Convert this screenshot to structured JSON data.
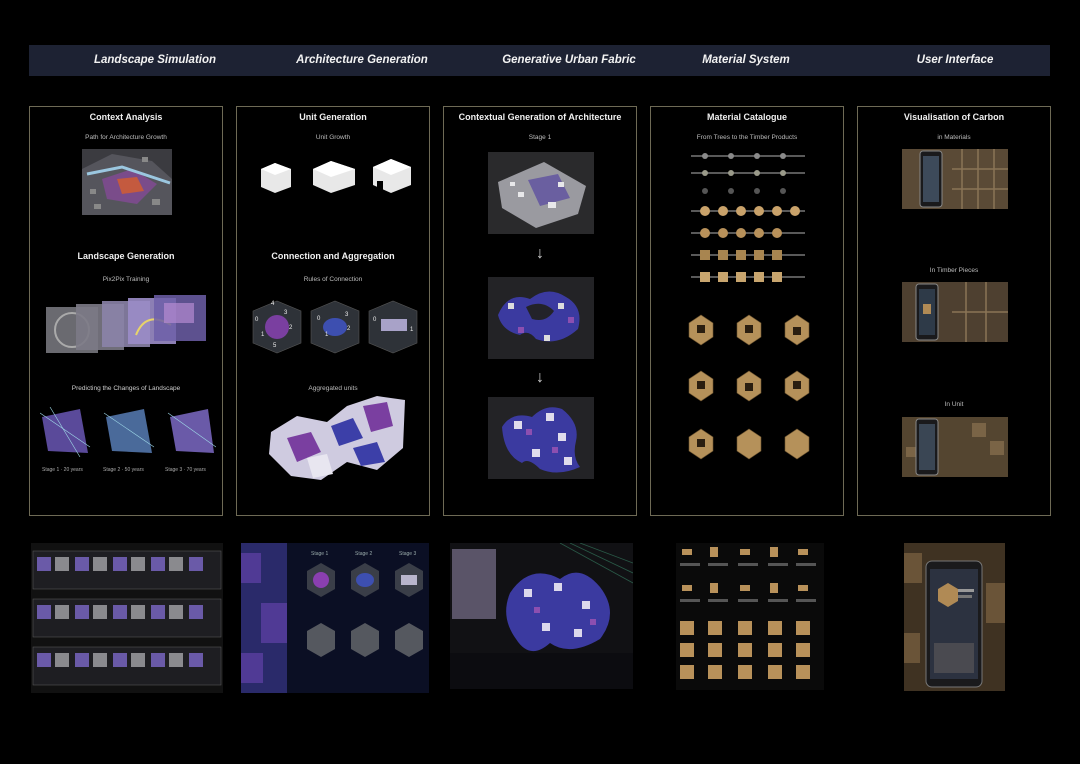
{
  "header": {
    "landscape": "Landscape Simulation",
    "architecture": "Architecture Generation",
    "urban": "Generative Urban Fabric",
    "material": "Material System",
    "ui": "User Interface"
  },
  "panel1": {
    "context_title": "Context Analysis",
    "context_sub": "Path for Architecture Growth",
    "landscape_title": "Landscape Generation",
    "landscape_sub": "Pix2Pix Training",
    "predict_title": "Predicting the Changes of Landscape",
    "stage1": "Stage 1 · 20 years",
    "stage2": "Stage 2 · 50 years",
    "stage3": "Stage 3 · 70 years"
  },
  "panel2": {
    "unit_title": "Unit Generation",
    "unit_sub": "Unit Growth",
    "conn_title": "Connection and Aggregation",
    "conn_sub": "Rules of Connection",
    "agg_sub": "Aggregated units",
    "n0": "0",
    "n1": "1",
    "n2": "2",
    "n3": "3",
    "n4": "4",
    "n5": "5",
    "m0": "0",
    "m1": "1",
    "m2": "2",
    "m3": "3",
    "k0": "0",
    "k1": "1"
  },
  "panel3": {
    "title": "Contextual Generation of Architecture",
    "stage": "Stage 1"
  },
  "panel4": {
    "title": "Material Catalogue",
    "sub": "From Trees to the Timber Products"
  },
  "panel5": {
    "title": "Visualisation of Carbon",
    "materials": "in Materials",
    "timber": "In Timber Pieces",
    "unit": "In Unit"
  },
  "bottom": {
    "arch_labels": [
      "Stage 1",
      "Stage 2",
      "Stage 3"
    ]
  },
  "colors": {
    "header_bg": "#1d2233",
    "panel_border": "#6e6a55",
    "accent_purple": "#4b3fa8",
    "accent_timber": "#b08a55"
  }
}
